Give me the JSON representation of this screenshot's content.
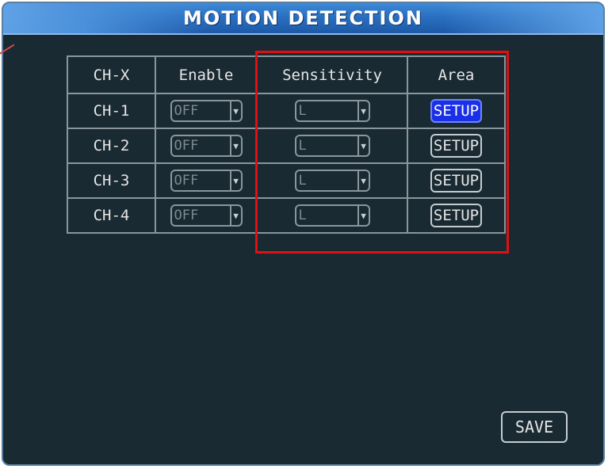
{
  "window": {
    "title": "MOTION DETECTION"
  },
  "table": {
    "headers": {
      "channel": "CH-X",
      "enable": "Enable",
      "sensitivity": "Sensitivity",
      "area": "Area"
    },
    "rows": [
      {
        "channel": "CH-1",
        "enable": "OFF",
        "sensitivity": "L",
        "area": "SETUP",
        "area_selected": true
      },
      {
        "channel": "CH-2",
        "enable": "OFF",
        "sensitivity": "L",
        "area": "SETUP",
        "area_selected": false
      },
      {
        "channel": "CH-3",
        "enable": "OFF",
        "sensitivity": "L",
        "area": "SETUP",
        "area_selected": false
      },
      {
        "channel": "CH-4",
        "enable": "OFF",
        "sensitivity": "L",
        "area": "SETUP",
        "area_selected": false
      }
    ]
  },
  "save_label": "SAVE",
  "colors": {
    "background": "#1a2a32",
    "titlebar": "#2a6fc0",
    "selected_button": "#1a2fe8",
    "highlight_box": "#e01010"
  },
  "icons": {
    "dropdown": "triangle-down"
  }
}
